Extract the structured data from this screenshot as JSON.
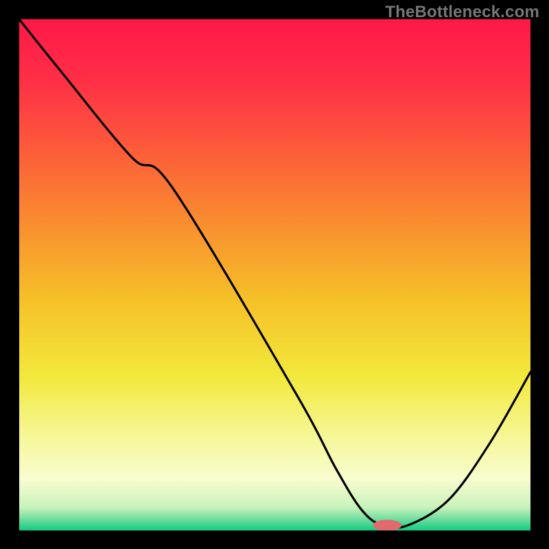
{
  "watermark": "TheBottleneck.com",
  "chart_data": {
    "type": "line",
    "title": "",
    "xlabel": "",
    "ylabel": "",
    "xlim": [
      0,
      100
    ],
    "ylim": [
      0,
      100
    ],
    "grid": false,
    "legend": false,
    "background_gradient_stops": [
      {
        "offset": 0.0,
        "color": "#ff1848"
      },
      {
        "offset": 0.12,
        "color": "#ff2f46"
      },
      {
        "offset": 0.25,
        "color": "#fc5a3a"
      },
      {
        "offset": 0.4,
        "color": "#f98e2f"
      },
      {
        "offset": 0.55,
        "color": "#f6c128"
      },
      {
        "offset": 0.7,
        "color": "#f2e93c"
      },
      {
        "offset": 0.82,
        "color": "#f6f89a"
      },
      {
        "offset": 0.9,
        "color": "#f9fccf"
      },
      {
        "offset": 0.955,
        "color": "#c8f3bb"
      },
      {
        "offset": 0.978,
        "color": "#6fdd9e"
      },
      {
        "offset": 1.0,
        "color": "#12cc80"
      }
    ],
    "series": [
      {
        "name": "bottleneck-curve",
        "x": [
          0,
          8,
          22,
          30,
          54,
          62,
          67,
          71,
          76,
          84,
          92,
          100
        ],
        "values": [
          100,
          90,
          73,
          67,
          27,
          12,
          4,
          1,
          1,
          6,
          17,
          31
        ]
      }
    ],
    "marker": {
      "name": "optimal-point",
      "x": 72,
      "y": 1,
      "rx": 2.8,
      "ry": 1.1,
      "color": "#e06a6c"
    }
  }
}
